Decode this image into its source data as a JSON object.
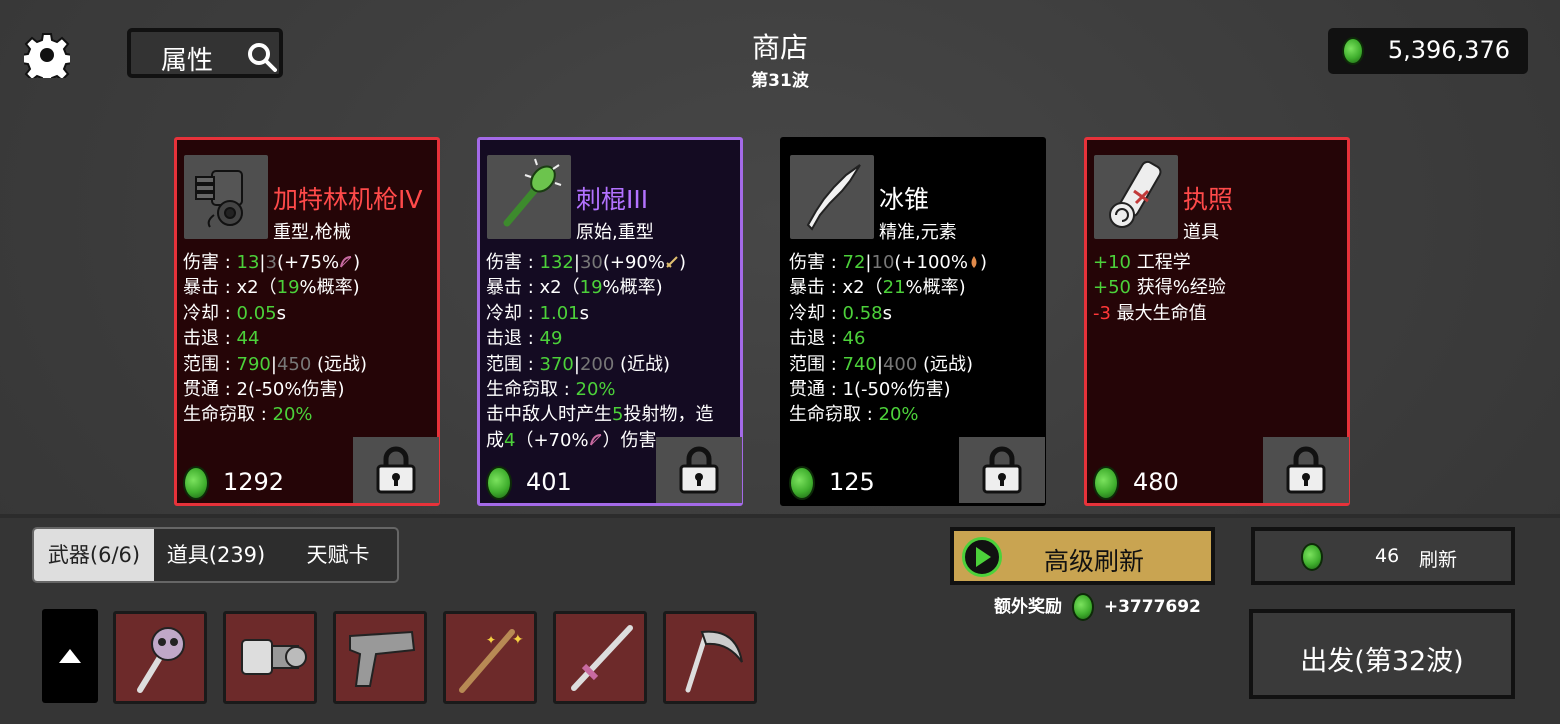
{
  "header": {
    "search_label": "属性",
    "title": "商店",
    "wave": "第31波",
    "money": "5,396,376"
  },
  "cards": [
    {
      "name": "加特林机枪IV",
      "name_color": "#ff4a4a",
      "tags": "重型,枪械",
      "price": "1292",
      "stats": [
        {
          "l": "伤害 : ",
          "g": "13",
          "sep": "|",
          "d": "3",
          "t": "(+75%",
          "icon": "bow",
          "end": ")"
        },
        {
          "l": "暴击 : x2（",
          "g": "19",
          "t": "%概率)"
        },
        {
          "l": "冷却 : ",
          "g": "0.05",
          "t": "s"
        },
        {
          "l": "击退 : ",
          "g": "44"
        },
        {
          "l": "范围 : ",
          "g": "790",
          "sep": "|",
          "d": "450",
          "t": " (远战)"
        },
        {
          "l": "贯通 : 2(-50%伤害)"
        },
        {
          "l": "生命窃取 : ",
          "g": "20%"
        }
      ]
    },
    {
      "name": "刺棍III",
      "name_color": "#b372ff",
      "tags": "原始,重型",
      "price": "401",
      "stats": [
        {
          "l": "伤害 : ",
          "g": "132",
          "sep": "|",
          "d": "30",
          "t": "(+90%",
          "icon": "sword",
          "end": ")"
        },
        {
          "l": "暴击 : x2（",
          "g": "19",
          "t": "%概率)"
        },
        {
          "l": "冷却 : ",
          "g": "1.01",
          "t": "s"
        },
        {
          "l": "击退 : ",
          "g": "49"
        },
        {
          "l": "范围 : ",
          "g": "370",
          "sep": "|",
          "d": "200",
          "t": " (近战)"
        },
        {
          "l": "生命窃取 : ",
          "g": "20%"
        },
        {
          "l": "击中敌人时产生",
          "g": "5",
          "t": "投射物，造"
        },
        {
          "l": "成",
          "g": "4",
          "t": "（+70%",
          "icon": "bow",
          "end": "）伤害"
        }
      ]
    },
    {
      "name": "冰锥",
      "name_color": "#ffffff",
      "tags": "精准,元素",
      "price": "125",
      "stats": [
        {
          "l": "伤害 : ",
          "g": "72",
          "sep": "|",
          "d": "10",
          "t": "(+100%",
          "icon": "drop",
          "end": ")"
        },
        {
          "l": "暴击 : x2（",
          "g": "21",
          "t": "%概率)"
        },
        {
          "l": "冷却 : ",
          "g": "0.58",
          "t": "s"
        },
        {
          "l": "击退 : ",
          "g": "46"
        },
        {
          "l": "范围 : ",
          "g": "740",
          "sep": "|",
          "d": "400",
          "t": " (远战)"
        },
        {
          "l": "贯通 : 1(-50%伤害)"
        },
        {
          "l": "生命窃取 : ",
          "g": "20%"
        }
      ]
    },
    {
      "name": "执照",
      "name_color": "#ff4a4a",
      "tags": "道具",
      "price": "480",
      "stats": [
        {
          "g": "+10",
          "t": " 工程学"
        },
        {
          "g": "+50",
          "t": " 获得%经验"
        },
        {
          "r": "-3",
          "t": " 最大生命值"
        }
      ]
    }
  ],
  "tabs": [
    "武器(6/6)",
    "道具(239)",
    "天赋卡"
  ],
  "advanced_refresh": "高级刷新",
  "extra_reward_label": "额外奖励",
  "extra_reward_value": "+3777692",
  "refresh_cost": "46",
  "refresh_label": "刷新",
  "go_button": "出发(第32波)",
  "inventory": [
    "skull-staff",
    "gatling",
    "pistol",
    "wand",
    "sword",
    "scythe"
  ]
}
